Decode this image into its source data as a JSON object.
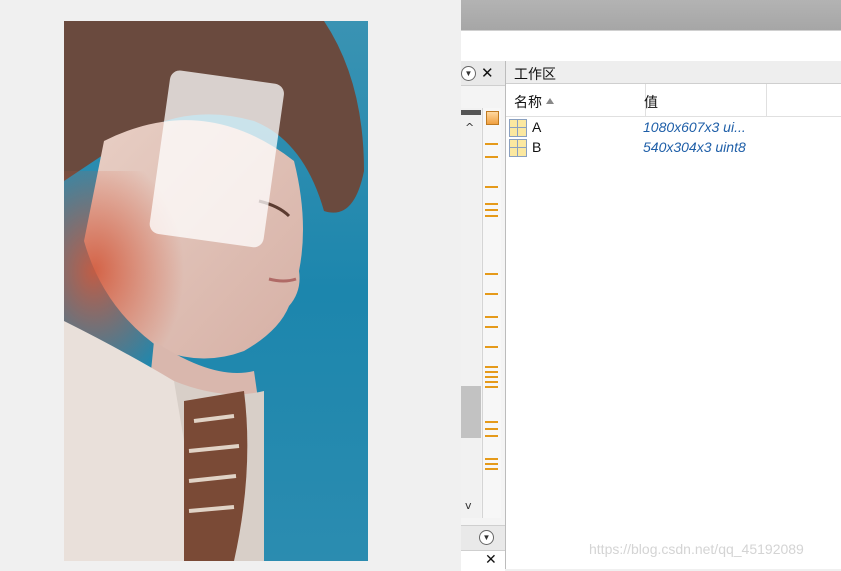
{
  "figure": {
    "image_alt": "portrait photo of a young man against a blue background"
  },
  "editor": {
    "close_label": "✕",
    "up_arrow": "^",
    "down_arrow": "v"
  },
  "workspace": {
    "title": "工作区",
    "columns": {
      "name": "名称",
      "value": "值"
    },
    "rows": [
      {
        "name": "A",
        "value": "1080x607x3 ui..."
      },
      {
        "name": "B",
        "value": "540x304x3 uint8"
      }
    ]
  },
  "watermark": "https://blog.csdn.net/qq_45192089",
  "colors": {
    "marker": "#e59a1a",
    "value_text": "#1f5fa8",
    "photo_background": "#1c86ad"
  }
}
